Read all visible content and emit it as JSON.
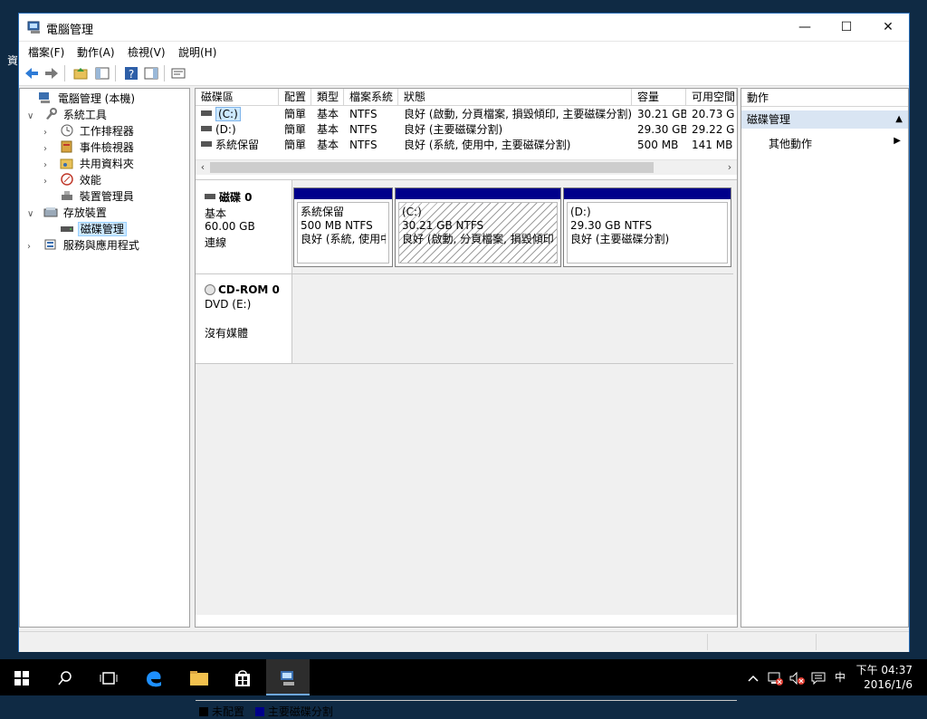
{
  "desktop": {
    "partial_label": "資"
  },
  "window": {
    "title": "電腦管理",
    "controls": {
      "minimize": "—",
      "maximize": "☐",
      "close": "✕"
    }
  },
  "menu": [
    "檔案(F)",
    "動作(A)",
    "檢視(V)",
    "說明(H)"
  ],
  "tree": [
    {
      "label": "電腦管理 (本機)",
      "expander": "",
      "icon": "computer-management-icon"
    },
    {
      "label": "系統工具",
      "expander": "∨",
      "icon": "tools-icon"
    },
    {
      "label": "工作排程器",
      "expander": "›",
      "icon": "clock-icon"
    },
    {
      "label": "事件檢視器",
      "expander": "›",
      "icon": "event-viewer-icon"
    },
    {
      "label": "共用資料夾",
      "expander": "›",
      "icon": "shared-folder-icon"
    },
    {
      "label": "效能",
      "expander": "›",
      "icon": "performance-icon"
    },
    {
      "label": "裝置管理員",
      "expander": "",
      "icon": "device-manager-icon"
    },
    {
      "label": "存放裝置",
      "expander": "∨",
      "icon": "storage-icon"
    },
    {
      "label": "磁碟管理",
      "expander": "",
      "icon": "disk-management-icon"
    },
    {
      "label": "服務與應用程式",
      "expander": "›",
      "icon": "services-icon"
    }
  ],
  "volumes": {
    "headers": [
      "磁碟區",
      "配置",
      "類型",
      "檔案系統",
      "狀態",
      "容量",
      "可用空間"
    ],
    "rows": [
      {
        "name": "(C:)",
        "layout": "簡單",
        "type": "基本",
        "fs": "NTFS",
        "status": "良好 (啟動, 分頁檔案, 損毀傾印, 主要磁碟分割)",
        "capacity": "30.21 GB",
        "free": "20.73 G"
      },
      {
        "name": "(D:)",
        "layout": "簡單",
        "type": "基本",
        "fs": "NTFS",
        "status": "良好 (主要磁碟分割)",
        "capacity": "29.30 GB",
        "free": "29.22 G"
      },
      {
        "name": "系統保留",
        "layout": "簡單",
        "type": "基本",
        "fs": "NTFS",
        "status": "良好 (系統, 使用中, 主要磁碟分割)",
        "capacity": "500 MB",
        "free": "141 MB"
      }
    ]
  },
  "disks": {
    "disk0": {
      "name": "磁碟 0",
      "type": "基本",
      "size": "60.00 GB",
      "state": "連線",
      "partitions": [
        {
          "title": "系統保留",
          "size": "500 MB NTFS",
          "status": "良好 (系統, 使用中"
        },
        {
          "title": "(C:)",
          "size": "30.21 GB NTFS",
          "status": "良好 (啟動, 分頁檔案, 損毀傾印,"
        },
        {
          "title": "(D:)",
          "size": "29.30 GB NTFS",
          "status": "良好 (主要磁碟分割)"
        }
      ]
    },
    "cdrom0": {
      "name": "CD-ROM 0",
      "type": "DVD (E:)",
      "state": "沒有媒體"
    }
  },
  "legend": {
    "unallocated": "未配置",
    "primary": "主要磁碟分割",
    "unallocated_color": "#000000",
    "primary_color": "#00008b"
  },
  "actions": {
    "title": "動作",
    "section": "磁碟管理",
    "item": "其他動作"
  },
  "taskbar": {
    "ime": "中",
    "clock_time": "下午 04:37",
    "clock_date": "2016/1/6"
  }
}
